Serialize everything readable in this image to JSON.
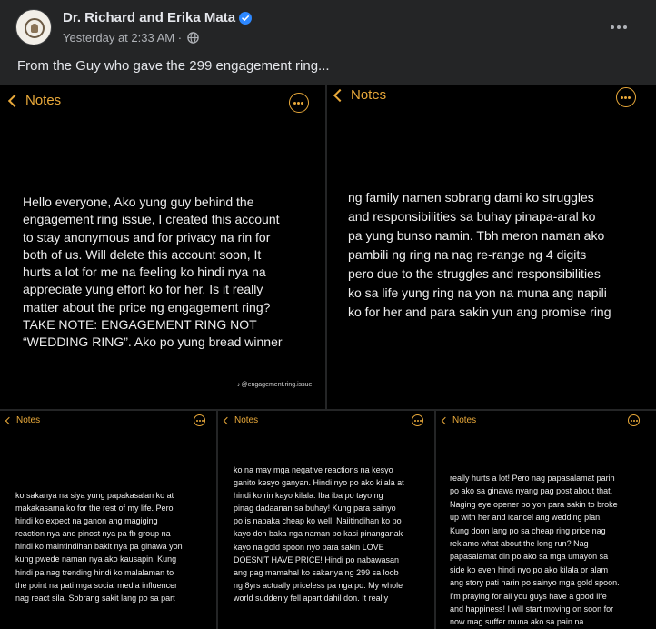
{
  "post": {
    "author": "Dr. Richard and Erika Mata",
    "time": "Yesterday at 2:33 AM",
    "separator": "·",
    "caption": "From the Guy who gave the 299 engagement ring..."
  },
  "icons": {
    "verified": "verified-badge-icon",
    "privacy": "globe-icon",
    "menu": "more-options-icon",
    "back": "chevron-left-icon",
    "note_menu": "ellipsis-circle-icon"
  },
  "colors": {
    "background": "#242526",
    "note_bg": "#000000",
    "notes_accent": "#e9a93a",
    "verified": "#2d88ff"
  },
  "screenshots": [
    {
      "back_label": "Notes",
      "body": "Hello everyone, Ako yung guy behind the\nengagement ring issue, I created this account\nto stay anonymous and for privacy na rin for\nboth of us. Will delete this account soon, It\nhurts a lot for me na feeling ko hindi nya na\nappreciate yung effort ko for her. Is it really\nmatter about the price ng engagement ring?\nTAKE NOTE: ENGAGEMENT RING NOT\n“WEDDING RING”. Ako po yung bread winner",
      "watermark": "@engagement.ring.issue"
    },
    {
      "back_label": "Notes",
      "body": "ng family namen sobrang dami ko struggles\nand responsibilities sa buhay pinapa-aral ko\npa yung bunso namin. Tbh meron naman ako\npambili ng ring na nag re-range ng 4 digits\npero due to the struggles and responsibilities\nko sa life yung ring na yon na muna ang napili\nko for her and para sakin yun ang promise ring"
    },
    {
      "back_label": "Notes",
      "body": "ko sakanya na siya yung papakasalan ko at\nmakakasama ko for the rest of my life. Pero\nhindi ko expect na ganon ang magiging\nreaction nya and pinost nya pa fb group na\nhindi ko maintindihan bakit nya pa ginawa yon\nkung pwede naman nya ako kausapin. Kung\nhindi pa nag trending hindi ko malalaman to\nthe point na pati mga social media influencer\nnag react sila. Sobrang sakit lang po sa part"
    },
    {
      "back_label": "Notes",
      "body": "ko na may mga negative reactions na kesyo\nganito kesyo ganyan. Hindi nyo po ako kilala at\nhindi ko rin kayo kilala. Iba iba po tayo ng\npinag dadaanan sa buhay! Kung para sainyo\npo is napaka cheap ko well  Naiitindihan ko po\nkayo don baka nga naman po kasi pinanganak\nkayo na gold spoon nyo para sakin LOVE\nDOESN'T HAVE PRICE! Hindi po nabawasan\nang pag mamahal ko sakanya ng 299 sa loob\nng 8yrs actually priceless pa nga po. My whole\nworld suddenly fell apart dahil don. It really"
    },
    {
      "back_label": "Notes",
      "body": "really hurts a lot! Pero nag papasalamat parin\npo ako sa ginawa nyang pag post about that.\nNaging eye opener po yon para sakin to broke\nup with her and icancel ang wedding plan.\nKung doon lang po sa cheap ring price nag\nreklamo what about the long run? Nag\npapasalamat din po ako sa mga umayon sa\nside ko even hindi nyo po ako kilala or alam\nang story pati narin po sainyo mga gold spoon.\nI'm praying for all you guys have a good life\nand happiness! I will start moving on soon for\nnow mag suffer muna ako sa pain na"
    }
  ]
}
